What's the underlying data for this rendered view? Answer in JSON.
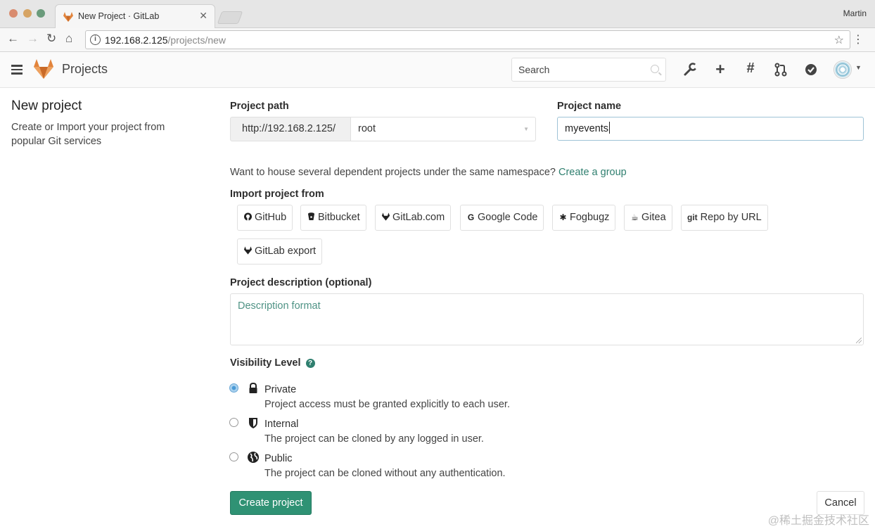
{
  "browser": {
    "tab_title": "New Project · GitLab",
    "profile": "Martin",
    "url_host": "192.168.2.125",
    "url_path": "/projects/new"
  },
  "header": {
    "title": "Projects",
    "search_placeholder": "Search",
    "icons": [
      "wrench-icon",
      "plus-icon",
      "hash-icon",
      "merge-request-icon",
      "todo-check-icon",
      "avatar"
    ]
  },
  "sidebar": {
    "title": "New project",
    "description": "Create or Import your project from popular Git services"
  },
  "form": {
    "project_path_label": "Project path",
    "path_prefix": "http://192.168.2.125/",
    "namespace": "root",
    "project_name_label": "Project name",
    "project_name_value": "myevents",
    "namespace_note": "Want to house several dependent projects under the same namespace?",
    "create_group_link": "Create a group",
    "import_label": "Import project from",
    "import_sources": [
      {
        "label": "GitHub",
        "icon": "github-icon"
      },
      {
        "label": "Bitbucket",
        "icon": "bitbucket-icon"
      },
      {
        "label": "GitLab.com",
        "icon": "gitlab-icon"
      },
      {
        "label": "Google Code",
        "icon": "google-icon"
      },
      {
        "label": "Fogbugz",
        "icon": "bug-icon"
      },
      {
        "label": "Gitea",
        "icon": "gitea-icon"
      },
      {
        "label": "Repo by URL",
        "icon": "git-icon",
        "prefix": "git"
      },
      {
        "label": "GitLab export",
        "icon": "gitlab-icon"
      }
    ],
    "description_label": "Project description (optional)",
    "description_placeholder": "Description format",
    "visibility_label": "Visibility Level",
    "visibility_options": [
      {
        "title": "Private",
        "description": "Project access must be granted explicitly to each user.",
        "icon": "lock-icon",
        "checked": true
      },
      {
        "title": "Internal",
        "description": "The project can be cloned by any logged in user.",
        "icon": "shield-icon",
        "checked": false
      },
      {
        "title": "Public",
        "description": "The project can be cloned without any authentication.",
        "icon": "globe-icon",
        "checked": false
      }
    ],
    "create_button": "Create project",
    "cancel_button": "Cancel"
  },
  "watermark": "@稀土掘金技术社区",
  "colors": {
    "accent": "#2f9274",
    "link": "#2f7f6f",
    "gitlab_orange": "#e2843c"
  }
}
